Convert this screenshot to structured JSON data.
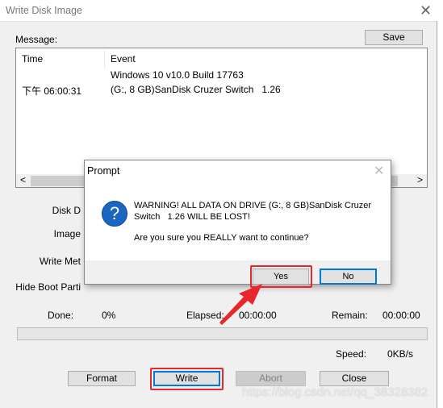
{
  "window": {
    "title": "Write Disk Image",
    "close_icon": "close-icon"
  },
  "message": {
    "label": "Message:",
    "save": "Save",
    "columns": [
      "Time",
      "Event"
    ],
    "rows": [
      {
        "time": "",
        "event": "Windows 10 v10.0 Build 17763"
      },
      {
        "time": "下午 06:00:31",
        "event": "(G:, 8 GB)SanDisk Cruzer Switch   1.26"
      }
    ]
  },
  "fields": {
    "disk": "Disk D",
    "image": "Image",
    "write_method": "Write Met",
    "hide_boot": "Hide Boot Parti"
  },
  "progress": {
    "done_label": "Done:",
    "done_value": "0%",
    "elapsed_label": "Elapsed:",
    "elapsed_value": "00:00:00",
    "remain_label": "Remain:",
    "remain_value": "00:00:00",
    "speed_label": "Speed:",
    "speed_value": "0KB/s",
    "percent": 0
  },
  "buttons": {
    "format": "Format",
    "write": "Write",
    "abort": "Abort",
    "close": "Close"
  },
  "prompt": {
    "title": "Prompt",
    "warning": "WARNING! ALL DATA ON DRIVE (G:, 8 GB)SanDisk Cruzer Switch   1.26 WILL BE LOST!",
    "question": "Are you sure you REALLY want to continue?",
    "yes": "Yes",
    "no": "No",
    "icon": "question-icon"
  },
  "watermark": "https://blog.csdn.net/qq_38328382",
  "colors": {
    "highlight": "#e8272a",
    "focus": "#0078d7"
  }
}
